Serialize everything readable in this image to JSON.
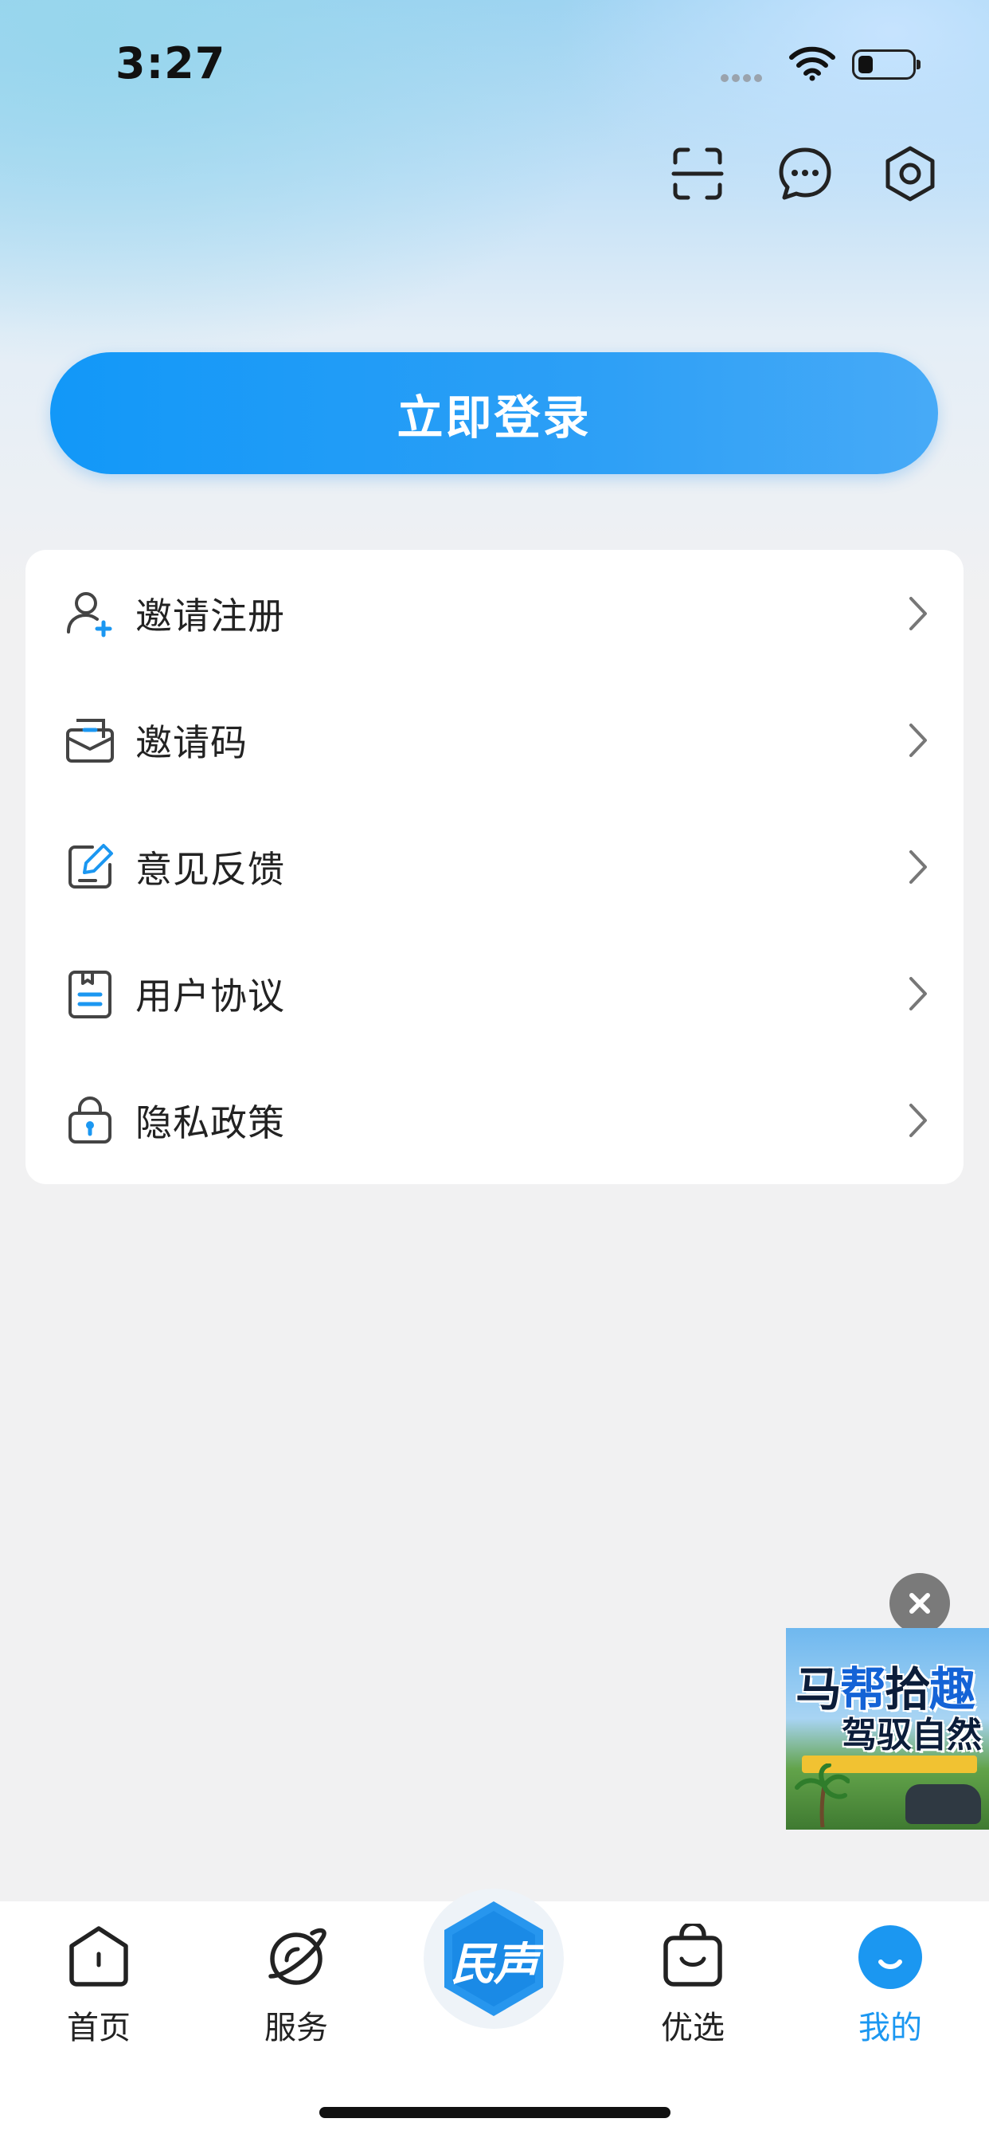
{
  "status_bar": {
    "time": "3:27",
    "icons": [
      "signal-icon",
      "wifi-icon",
      "battery-icon"
    ]
  },
  "header": {
    "icons": [
      "scan-icon",
      "message-icon",
      "settings-icon"
    ]
  },
  "login": {
    "label": "立即登录"
  },
  "menu": {
    "items": [
      {
        "label": "邀请注册",
        "icon": "add-user-icon"
      },
      {
        "label": "邀请码",
        "icon": "mail-icon"
      },
      {
        "label": "意见反馈",
        "icon": "edit-icon"
      },
      {
        "label": "用户协议",
        "icon": "document-icon"
      },
      {
        "label": "隐私政策",
        "icon": "lock-icon"
      }
    ]
  },
  "ad": {
    "line1_a": "马",
    "line1_b": "帮",
    "line1_c": "拾",
    "line1_d": "趣",
    "line2": "驾驭自然"
  },
  "tabs": {
    "items": [
      {
        "label": "首页",
        "icon": "home-icon"
      },
      {
        "label": "服务",
        "icon": "planet-icon"
      },
      {
        "label": "优选",
        "icon": "shopping-bag-icon"
      },
      {
        "label": "我的",
        "icon": "profile-icon"
      }
    ],
    "center_label": "民声",
    "active": "我的"
  },
  "colors": {
    "accent": "#1b97f1",
    "login_gradient_start": "#1298f8",
    "login_gradient_end": "#47aaf7",
    "page_background": "#f1f1f2"
  }
}
